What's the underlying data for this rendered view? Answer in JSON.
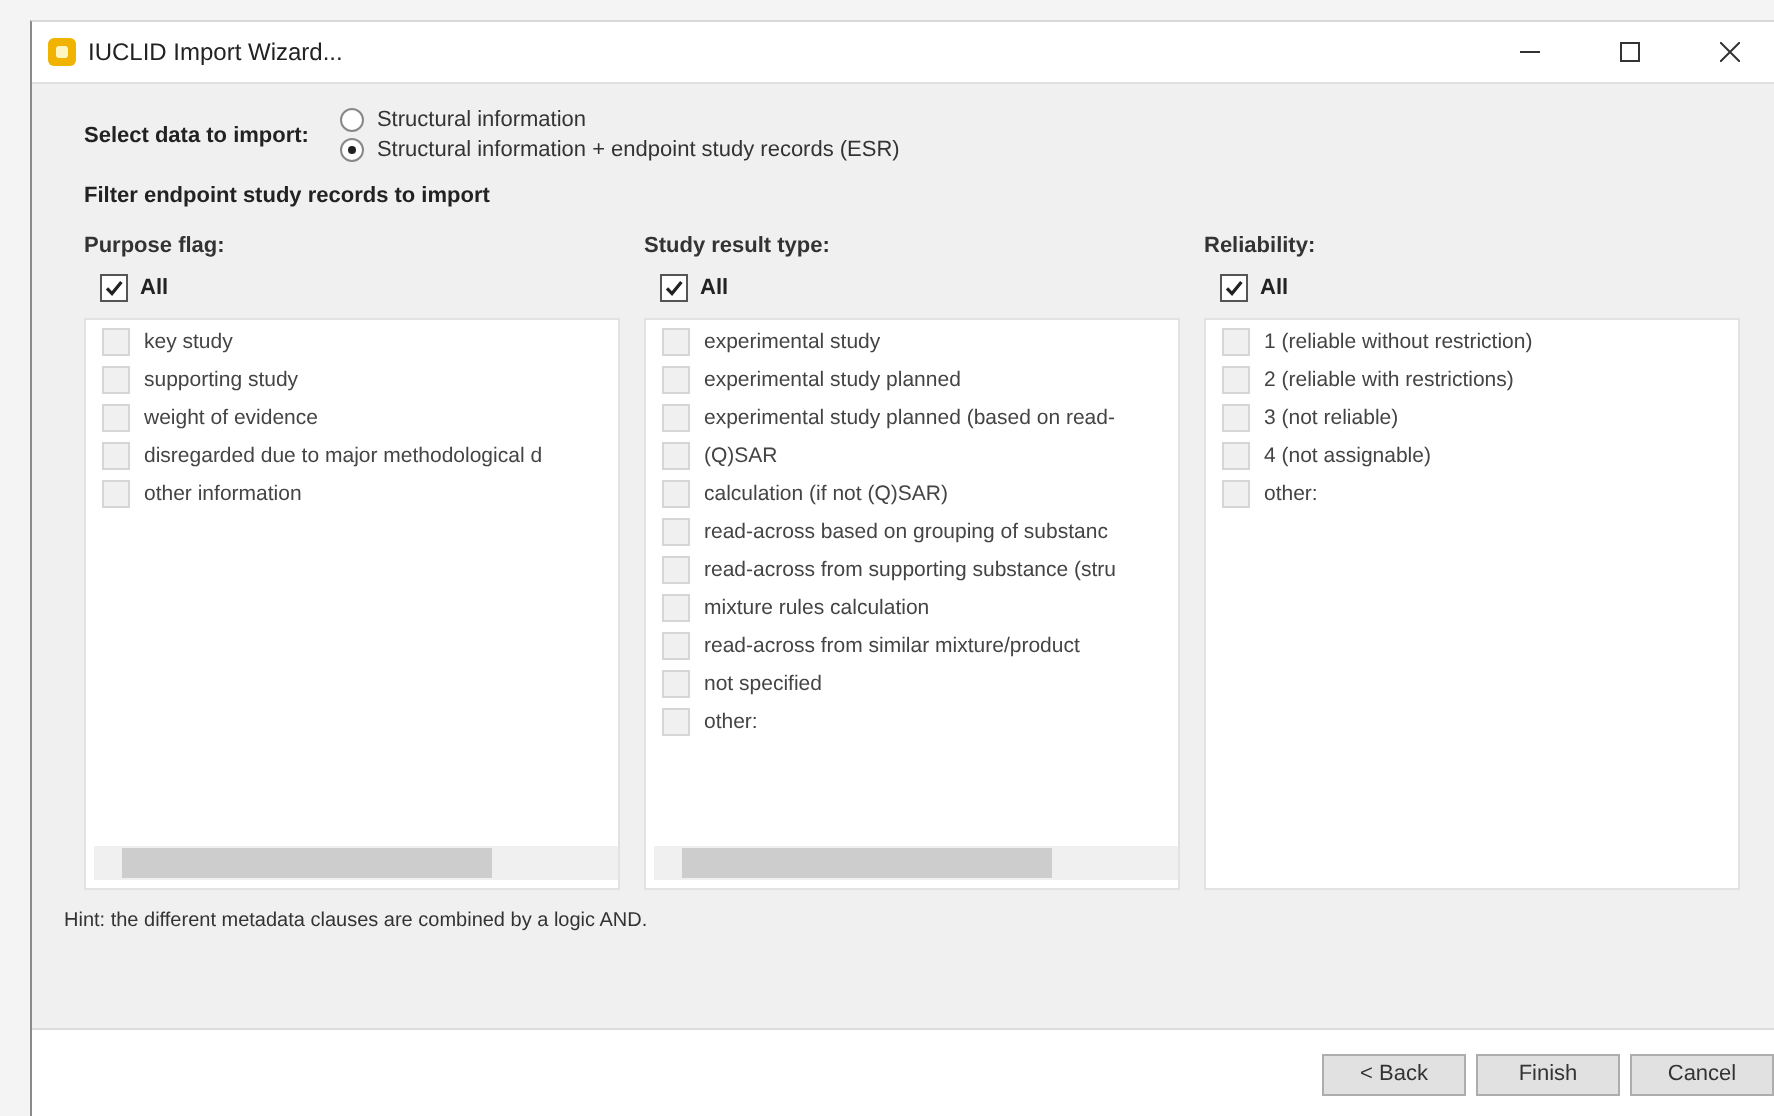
{
  "window": {
    "title": "IUCLID Import Wizard..."
  },
  "select_data": {
    "label": "Select data to import:",
    "options": [
      {
        "label": "Structural information",
        "selected": false
      },
      {
        "label": "Structural information + endpoint study records (ESR)",
        "selected": true
      }
    ]
  },
  "filter_heading": "Filter endpoint study records to import",
  "filters": [
    {
      "label": "Purpose flag:",
      "all": {
        "label": "All",
        "checked": true
      },
      "scrollbar": true,
      "items": [
        {
          "label": "key study",
          "checked": false
        },
        {
          "label": "supporting study",
          "checked": false
        },
        {
          "label": "weight of evidence",
          "checked": false
        },
        {
          "label": "disregarded due to major methodological d",
          "checked": false
        },
        {
          "label": "other information",
          "checked": false
        }
      ]
    },
    {
      "label": "Study result type:",
      "all": {
        "label": "All",
        "checked": true
      },
      "scrollbar": true,
      "items": [
        {
          "label": "experimental study",
          "checked": false
        },
        {
          "label": "experimental study planned",
          "checked": false
        },
        {
          "label": "experimental study planned (based on read-",
          "checked": false
        },
        {
          "label": "(Q)SAR",
          "checked": false
        },
        {
          "label": "calculation (if not (Q)SAR)",
          "checked": false
        },
        {
          "label": "read-across based on grouping of substanc",
          "checked": false
        },
        {
          "label": "read-across from supporting substance (stru",
          "checked": false
        },
        {
          "label": "mixture rules calculation",
          "checked": false
        },
        {
          "label": "read-across from similar mixture/product",
          "checked": false
        },
        {
          "label": "not specified",
          "checked": false
        },
        {
          "label": "other:",
          "checked": false
        }
      ]
    },
    {
      "label": "Reliability:",
      "all": {
        "label": "All",
        "checked": true
      },
      "scrollbar": false,
      "items": [
        {
          "label": "1 (reliable without restriction)",
          "checked": false
        },
        {
          "label": "2 (reliable with restrictions)",
          "checked": false
        },
        {
          "label": "3 (not reliable)",
          "checked": false
        },
        {
          "label": "4 (not assignable)",
          "checked": false
        },
        {
          "label": "other:",
          "checked": false
        }
      ]
    }
  ],
  "hint": "Hint: the different metadata clauses are combined by a logic AND.",
  "buttons": [
    "< Back",
    "Finish",
    "Cancel"
  ]
}
